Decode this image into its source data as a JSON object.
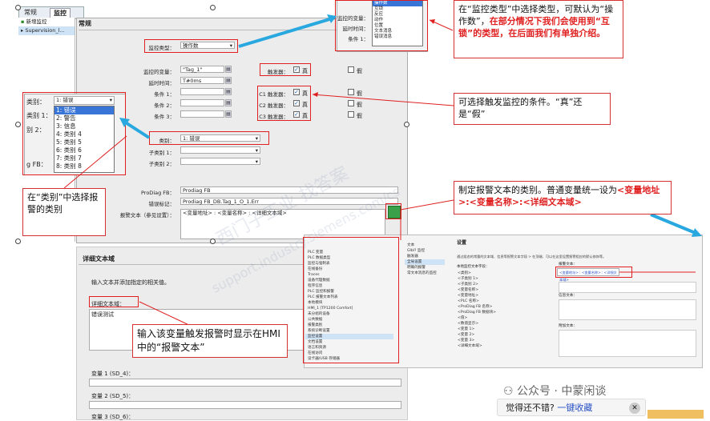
{
  "tabs": [
    "常规",
    "监控"
  ],
  "left_items": [
    "新增监控",
    "Supervision_l..."
  ],
  "section_title": "常规",
  "fields": {
    "supervision_type_label": "监控类型：",
    "supervision_type_value": "操作数",
    "tag_label": "监控的变量：",
    "tag_value": "\"Tag_1\"",
    "delay_label": "延时时间：",
    "delay_value": "T#0ms",
    "cond1_label": "条件 1：",
    "cond2_label": "条件 2：",
    "cond3_label": "条件 3：",
    "trigger_label": "触发器：",
    "c1_label": "C1 触发器：",
    "c2_label": "C2 触发器：",
    "c3_label": "C3 触发器：",
    "true_label": "真",
    "false_label": "假",
    "category_label": "类别：",
    "category_value": "1: 错误",
    "sub1_label": "子类别 1：",
    "sub2_label": "子类别 2：",
    "prodiag_label": "ProDiag FB：",
    "prodiag_value": "Prodiag FB",
    "errmark_label": "错误标记：",
    "errmark_value": "Prodiag FB_DB.Tag_1_O_1.Err",
    "alarmtext_label": "报警文本（参见设置）：",
    "alarmtext_value": "<变量地址> : <变量名称> : <详细文本域>"
  },
  "type_dropdown": [
    "操作数",
    "互锁",
    "反应",
    "动作",
    "位置",
    "文本消息",
    "错误消息"
  ],
  "type_dropdown_labels": [
    "监控的变量：",
    "延时时间：",
    "条件 1："
  ],
  "category_dropdown": {
    "label": "类别：",
    "value": "1: 错误",
    "options": [
      "1: 错误",
      "2: 警告",
      "3: 信息",
      "4: 类别 4",
      "5: 类别 5",
      "6: 类别 6",
      "7: 类别 7",
      "8: 类别 8"
    ],
    "side_labels": [
      "类别 1：",
      "别 2："
    ],
    "fb_label": "g FB："
  },
  "notes": {
    "type_note_plain": "在“监控类型”中选择类型，可默认为“操作数”，",
    "type_note_red": "在部分情况下我们会使用到“互锁”的类型，在后面我们有单独介绍。",
    "trigger_note": "可选择触发监控的条件。“真”还是“假”",
    "category_note": "在“类别”中选择报警的类别",
    "alarm_note_plain": "制定报警文本的类别。普通变量统一设为",
    "alarm_note_red": "<变量地址>:<变量名称>:<详细文本域>",
    "detail_note": "输入该变量触发报警时显示在HMI中的“报警文本”"
  },
  "lower": {
    "title": "详细文本域",
    "hint": "输入文本并添加指定的相关值。",
    "detail_label": "详细文本域：",
    "detail_value": "错误测试",
    "var1": "变量 1 (SD_4)：",
    "var2": "变量 2 (SD_5)：",
    "var3": "变量 3 (SD_6)："
  },
  "inset": {
    "tree": [
      "PLC 变量",
      "PLC 数据类型",
      "监控与强制表",
      "在线备份",
      "Traces",
      "设备代理数据",
      "程序信息",
      "PLC 监控和报警",
      "PLC 报警文本列表",
      "本地模块",
      "HMI_1 [TP1200 Comfort]",
      "未分组的设备",
      "公共数据",
      "报警类别",
      "系统诊断设置",
      "监控设置",
      "文档设置",
      "语言和资源",
      "在线访问",
      "读卡器/USB 存储器"
    ],
    "menu": [
      "文本",
      "Glbl? 监控",
      "触发器",
      "全局设置",
      "明确的报警",
      "常文本消息的监控"
    ],
    "header": "设置",
    "desc": "通过组态的常量的文本域、信息等报警文本字段 > 在顶端、可以在这里设置报警相应的默认修饰等。",
    "alarm_text_label": "报警文本：",
    "alarm_text_value": "<变量地址> : <变量名称> : <详细文本域>",
    "list_title": "本地监控文本字段：",
    "list": [
      "<类别>",
      "<子类别 1>",
      "<子类别 2>",
      "<变量名称>",
      "<变量地址>",
      "<PLC 名称>",
      "<ProDiag FB 名称>",
      "<ProDiag FB 数据块>",
      "<值>",
      "<数值显示>",
      "<变量 1>",
      "<变量 2>",
      "<变量 3>",
      "<详细文本域>"
    ],
    "info_label": "信息文本：",
    "extra_label": "附加文本："
  },
  "watermarks": [
    "西门子工业  找答案",
    "support.industry.siemens.com/cs"
  ],
  "wechat": "公众号 · 中蒙闲谈",
  "footer": {
    "text": "觉得还不错?",
    "link": "一键收藏"
  },
  "colors": {
    "red": "#e02020",
    "arrow": "#29a8e0"
  }
}
